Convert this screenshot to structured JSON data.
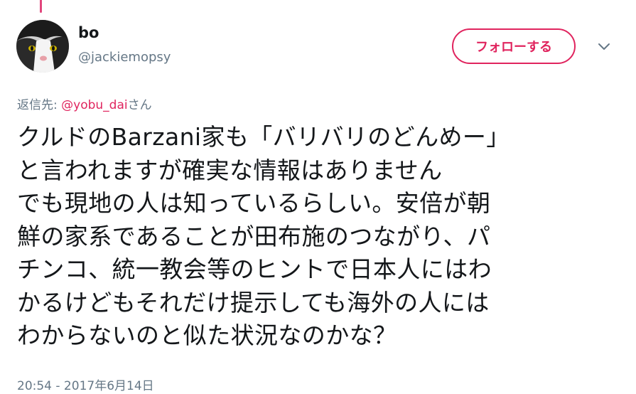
{
  "colors": {
    "accent": "#e0245e",
    "thread_line": "#e1467c",
    "secondary_text": "#657786",
    "primary_text": "#14171a"
  },
  "user": {
    "display_name": "bo",
    "screen_name": "@jackiemopsy",
    "avatar_icon": "cat-avatar"
  },
  "actions": {
    "follow_label": "フォローする",
    "menu_icon": "chevron-down-icon"
  },
  "reply": {
    "prefix": "返信先: ",
    "mention": "@yobu_dai",
    "suffix": "さん"
  },
  "tweet": {
    "lines": [
      "クルドのBarzani家も「バリバリのどんめー」",
      "と言われますが確実な情報はありません",
      "でも現地の人は知っているらしい。安倍が朝",
      "鮮の家系であることが田布施のつながり、パ",
      "チンコ、統一教会等のヒントで日本人にはわ",
      "かるけどもそれだけ提示しても海外の人には",
      "わからないのと似た状況なのかな？"
    ],
    "timestamp": "20:54 - 2017年6月14日"
  }
}
